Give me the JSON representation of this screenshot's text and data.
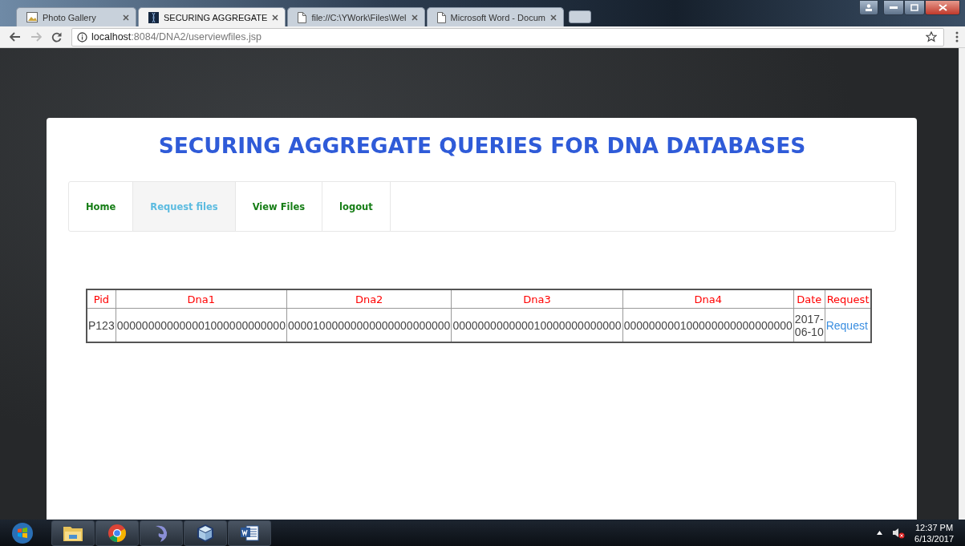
{
  "browser": {
    "tabs": [
      {
        "title": "Photo Gallery",
        "selected": false
      },
      {
        "title": "SECURING AGGREGATE",
        "selected": true
      },
      {
        "title": "file://C:\\YWork\\Files\\Wel",
        "selected": false
      },
      {
        "title": "Microsoft Word - Docum",
        "selected": false
      }
    ],
    "address": {
      "host": "localhost",
      "path": ":8084/DNA2/userviewfiles.jsp"
    }
  },
  "page": {
    "title": "SECURING AGGREGATE QUERIES FOR DNA DATABASES",
    "nav": [
      {
        "label": "Home",
        "selected": false
      },
      {
        "label": "Request files",
        "selected": true
      },
      {
        "label": "View Files",
        "selected": false
      },
      {
        "label": "logout",
        "selected": false
      }
    ],
    "table": {
      "columns": [
        "Pid",
        "Dna1",
        "Dna2",
        "Dna3",
        "Dna4",
        "Date",
        "Request"
      ],
      "rows": [
        {
          "cells": [
            "P123",
            "000000000000001000000000000",
            "00001000000000000000000000",
            "000000000000010000000000000",
            "000000000100000000000000000",
            "2017-06-10"
          ],
          "link": "Request"
        }
      ]
    }
  },
  "taskbar": {
    "time": "12:37 PM",
    "date": "6/13/2017"
  }
}
